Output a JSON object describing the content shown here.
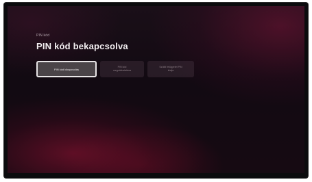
{
  "screen": {
    "section_label": "PIN kód",
    "title": "PIN kód bekapcsolva",
    "options": [
      {
        "label": "PIN kód kikapcsolás",
        "selected": true
      },
      {
        "label": "PIN kód\nmegváltoztatása",
        "selected": false
      },
      {
        "label": "Szülői felügyelet PIN\nkódja",
        "selected": false
      }
    ]
  },
  "colors": {
    "accent": "#e9e6e8",
    "background_glow": "#8c1234"
  }
}
